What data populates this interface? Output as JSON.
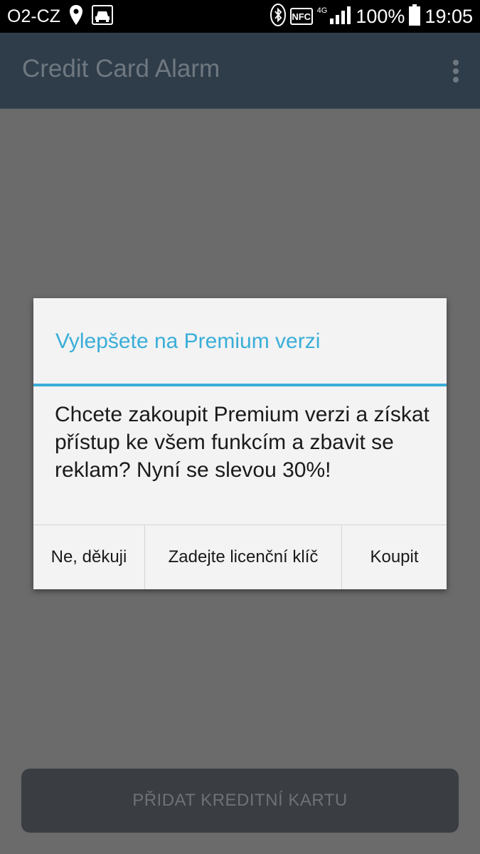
{
  "status_bar": {
    "carrier": "O2-CZ",
    "nfc_label": "NFC",
    "network_type": "4G",
    "battery_percent": "100%",
    "time": "19:05",
    "icons": [
      "location-pin-icon",
      "car-icon",
      "bluetooth-icon",
      "nfc-icon",
      "signal-icon",
      "battery-icon"
    ]
  },
  "app_bar": {
    "title": "Credit Card Alarm",
    "overflow_icon": "overflow-menu-icon"
  },
  "dialog": {
    "title": "Vylepšete na Premium verzi",
    "message": "Chcete zakoupit Premium verzi a získat přístup ke všem funkcím a zbavit se reklam? Nyní se slevou 30%!",
    "buttons": {
      "no": "Ne, děkuji",
      "license": "Zadejte licenční klíč",
      "buy": "Koupit"
    }
  },
  "bottom": {
    "add_card_label": "PŘIDAT KREDITNÍ KARTU"
  },
  "colors": {
    "accent": "#3aaed8",
    "overlay": "#6b6b6b",
    "app_bar": "#2f3d4a",
    "dialog_bg": "#f3f3f3"
  }
}
